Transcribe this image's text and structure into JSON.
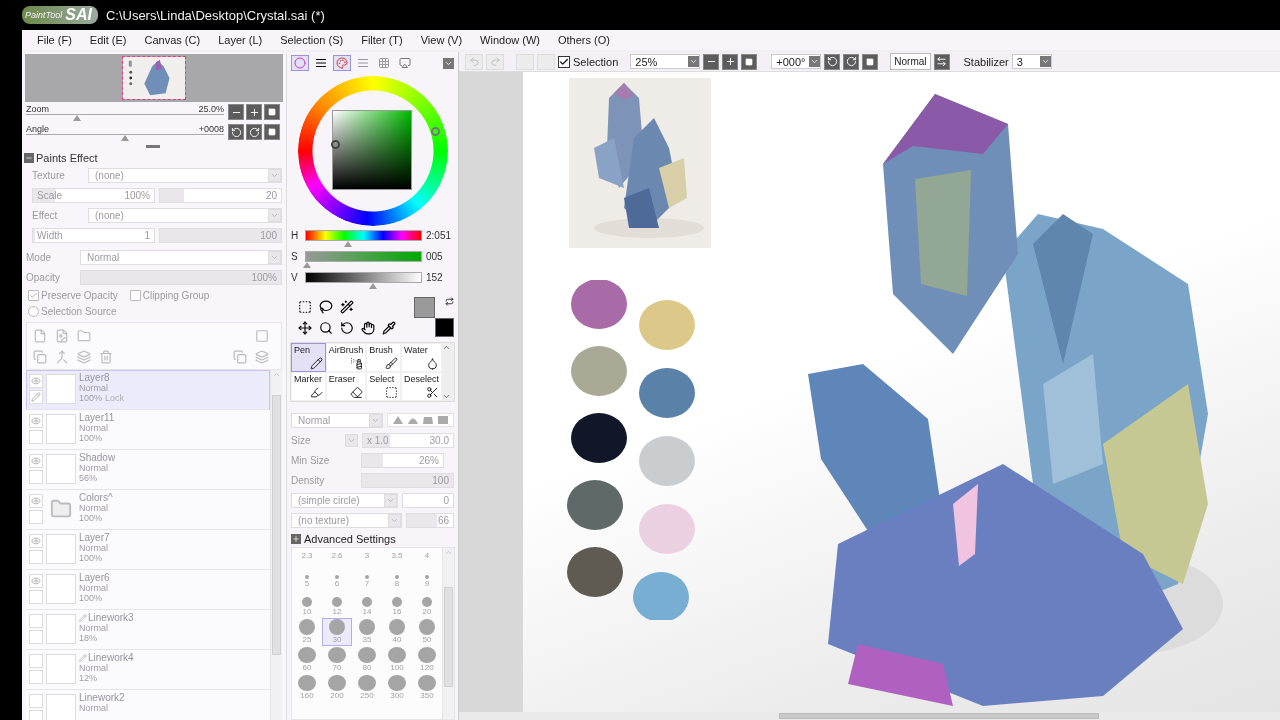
{
  "title_bar": {
    "logo_small": "PaintTool",
    "logo_large": "SAI",
    "path": "C:\\Users\\Linda\\Desktop\\Crystal.sai (*)"
  },
  "menu": [
    "File (F)",
    "Edit (E)",
    "Canvas (C)",
    "Layer (L)",
    "Selection (S)",
    "Filter (T)",
    "View (V)",
    "Window (W)",
    "Others (O)"
  ],
  "navigator": {
    "zoom": {
      "label": "Zoom",
      "value": "25.0%",
      "level": 0.26
    },
    "angle": {
      "label": "Angle",
      "value": "+0008",
      "level": 0.5
    }
  },
  "paints_effect": {
    "title": "Paints Effect",
    "texture": {
      "label": "Texture",
      "value": "(none)"
    },
    "scale": {
      "label": "Scale",
      "value": "100%",
      "level": 0.18,
      "amount": {
        "value": "20",
        "level": 0.2
      }
    },
    "effect": {
      "label": "Effect",
      "value": "(none)"
    },
    "width": {
      "label": "Width",
      "value": "1",
      "level": 0.02,
      "amount": {
        "value": "100",
        "level": 1
      }
    }
  },
  "layer_props": {
    "mode": {
      "label": "Mode",
      "value": "Normal"
    },
    "opacity": {
      "label": "Opacity",
      "value": "100%",
      "level": 1
    },
    "preserve_opacity": {
      "label": "Preserve Opacity",
      "checked": true
    },
    "clipping_group": {
      "label": "Clipping Group",
      "checked": false
    },
    "selection_source": {
      "label": "Selection Source",
      "checked": false
    }
  },
  "layers": [
    {
      "name": "Layer8",
      "mode": "Normal",
      "opacity": "100%",
      "lock": "Lock",
      "kind": "layer",
      "visible": true,
      "selected": true
    },
    {
      "name": "Layer11",
      "mode": "Normal",
      "opacity": "100%",
      "kind": "layer",
      "visible": true,
      "selected": false
    },
    {
      "name": "Shadow",
      "mode": "Normal",
      "opacity": "56%",
      "kind": "layer",
      "visible": true,
      "selected": false
    },
    {
      "name": "Colors^",
      "mode": "Normal",
      "opacity": "100%",
      "kind": "folder",
      "visible": true,
      "selected": false
    },
    {
      "name": "Layer7",
      "mode": "Normal",
      "opacity": "100%",
      "kind": "layer",
      "visible": true,
      "selected": false
    },
    {
      "name": "Layer6",
      "mode": "Normal",
      "opacity": "100%",
      "kind": "layer",
      "visible": true,
      "selected": false
    },
    {
      "name": "Linework3",
      "mode": "Normal",
      "opacity": "18%",
      "kind": "linework",
      "visible": false,
      "selected": false
    },
    {
      "name": "Linework4",
      "mode": "Normal",
      "opacity": "12%",
      "kind": "linework",
      "visible": false,
      "selected": false
    },
    {
      "name": "Linework2",
      "mode": "Normal",
      "kind": "layer",
      "visible": false,
      "selected": false
    }
  ],
  "color_tabs": [
    {
      "kind": "wheel",
      "selected": true
    },
    {
      "kind": "rgb",
      "selected": false
    },
    {
      "kind": "hsv",
      "selected": true
    },
    {
      "kind": "swatches",
      "selected": false
    },
    {
      "kind": "scratch",
      "selected": false
    },
    {
      "kind": "mixer",
      "selected": false
    }
  ],
  "hsv": [
    {
      "label": "H",
      "value": "2:051",
      "level": 0.37,
      "kind": "hue"
    },
    {
      "label": "S",
      "value": "005",
      "level": 0.02,
      "kind": "saturation"
    },
    {
      "label": "V",
      "value": "152",
      "level": 0.58,
      "kind": "value"
    }
  ],
  "brush_tools": [
    {
      "label": "Pen",
      "kind": "pen",
      "selected": true
    },
    {
      "label": "AirBrush",
      "kind": "airbrush",
      "selected": false
    },
    {
      "label": "Brush",
      "kind": "brush",
      "selected": false
    },
    {
      "label": "Water",
      "kind": "water",
      "selected": false
    },
    {
      "label": "Marker",
      "kind": "marker",
      "selected": false
    },
    {
      "label": "Eraser",
      "kind": "eraser",
      "selected": false
    },
    {
      "label": "Select",
      "kind": "select",
      "selected": false
    },
    {
      "label": "Deselect",
      "kind": "deselect",
      "selected": false
    }
  ],
  "brush_settings": {
    "mode": "Normal",
    "size": {
      "label": "Size",
      "multiplier": "x 1.0",
      "value": "30.0",
      "level": 0.3
    },
    "min_size": {
      "label": "Min Size",
      "value": "26%",
      "level": 0.26
    },
    "density": {
      "label": "Density",
      "value": "100",
      "level": 1
    },
    "shape": {
      "value": "(simple circle)",
      "amount": "0"
    },
    "texture": {
      "value": "(no texture)",
      "amount": "66",
      "level": 0.66
    },
    "advanced": "Advanced Settings"
  },
  "brush_sizes": [
    {
      "label": "2.3",
      "selected": false
    },
    {
      "label": "2.6",
      "selected": false
    },
    {
      "label": "3",
      "selected": false
    },
    {
      "label": "3.5",
      "selected": false
    },
    {
      "label": "4",
      "selected": false
    },
    {
      "label": "5",
      "selected": false
    },
    {
      "label": "6",
      "selected": false
    },
    {
      "label": "7",
      "selected": false
    },
    {
      "label": "8",
      "selected": false
    },
    {
      "label": "9",
      "selected": false
    },
    {
      "label": "10",
      "selected": false
    },
    {
      "label": "12",
      "selected": false
    },
    {
      "label": "14",
      "selected": false
    },
    {
      "label": "16",
      "selected": false
    },
    {
      "label": "20",
      "selected": false
    },
    {
      "label": "25",
      "selected": false
    },
    {
      "label": "30",
      "selected": true
    },
    {
      "label": "35",
      "selected": false
    },
    {
      "label": "40",
      "selected": false
    },
    {
      "label": "50",
      "selected": false
    },
    {
      "label": "60",
      "selected": false
    },
    {
      "label": "70",
      "selected": false
    },
    {
      "label": "80",
      "selected": false
    },
    {
      "label": "100",
      "selected": false
    },
    {
      "label": "120",
      "selected": false
    },
    {
      "label": "160",
      "selected": false
    },
    {
      "label": "200",
      "selected": false
    },
    {
      "label": "250",
      "selected": false
    },
    {
      "label": "300",
      "selected": false
    },
    {
      "label": "350",
      "selected": false
    }
  ],
  "toolbar": {
    "selection": {
      "label": "Selection",
      "checked": true
    },
    "zoom": "25%",
    "angle": "+000°",
    "blend": "Normal",
    "stabilizer": {
      "label": "Stabilizer",
      "value": "3"
    }
  },
  "canvas": {
    "swatches": [
      {
        "color": "#a96aa8"
      },
      {
        "color": "#dcc98a"
      },
      {
        "color": "#a9a996"
      },
      {
        "color": "#5a82a9"
      },
      {
        "color": "#111628"
      },
      {
        "color": "#c9cdd0"
      },
      {
        "color": "#5f6a68"
      },
      {
        "color": "#ebd0e2"
      },
      {
        "color": "#5f5a52"
      },
      {
        "color": "#79aed3"
      }
    ]
  }
}
